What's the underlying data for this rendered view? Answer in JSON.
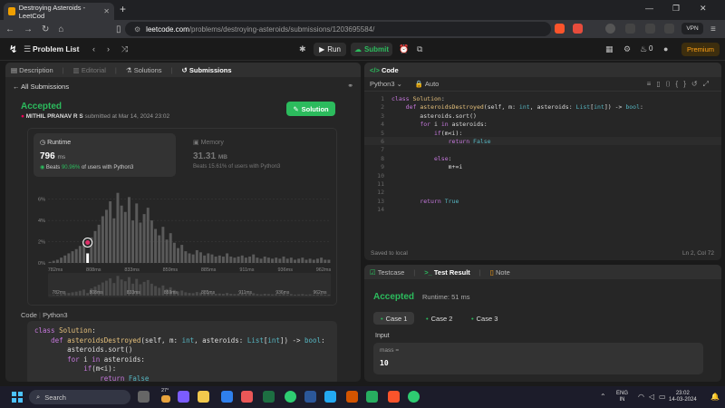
{
  "browser": {
    "tab_title": "Destroying Asteroids - LeetCod",
    "url_host": "leetcode.com",
    "url_path": "/problems/destroying-asteroids/submissions/1203695584/",
    "vpn_label": "VPN"
  },
  "header": {
    "problem_list": "Problem List",
    "run": "Run",
    "submit": "Submit",
    "streak_count": "0",
    "premium": "Premium"
  },
  "left_tabs": [
    "Description",
    "Editorial",
    "Solutions",
    "Submissions"
  ],
  "submission": {
    "back_label": "All Submissions",
    "status": "Accepted",
    "user": "MITHIL PRANAV R S",
    "submitted_text": "submitted at Mar 14, 2024 23:02",
    "solution_button": "Solution",
    "runtime_label": "Runtime",
    "runtime_value": "796",
    "runtime_unit": "ms",
    "runtime_beats_pre": "Beats",
    "runtime_beats_pct": "90.96%",
    "runtime_beats_post": "of users with Python3",
    "memory_label": "Memory",
    "memory_value": "31.31",
    "memory_unit": "MB",
    "memory_beats": "Beats 15.61% of users with Python3",
    "code_label": "Code",
    "code_lang": "Python3"
  },
  "chart_data": {
    "type": "bar",
    "title": "",
    "xlabel": "",
    "ylabel": "",
    "y_ticks": [
      "6%",
      "4%",
      "2%",
      "0%"
    ],
    "ylim": [
      0,
      7
    ],
    "x_ticks": [
      "782ms",
      "808ms",
      "833ms",
      "859ms",
      "885ms",
      "911ms",
      "936ms",
      "962ms"
    ],
    "values": [
      0.1,
      0.2,
      0.3,
      0.5,
      0.7,
      0.9,
      1.1,
      1.3,
      1.6,
      2.0,
      0.9,
      2.4,
      3.0,
      3.6,
      4.4,
      5.0,
      5.8,
      4.2,
      6.6,
      5.4,
      4.8,
      6.2,
      4.0,
      5.6,
      3.8,
      4.6,
      5.2,
      4.0,
      3.2,
      2.6,
      3.4,
      2.2,
      2.8,
      1.9,
      1.4,
      1.7,
      1.1,
      0.9,
      0.8,
      1.2,
      1.0,
      0.7,
      0.9,
      0.8,
      0.6,
      0.7,
      0.6,
      0.9,
      0.6,
      0.5,
      0.6,
      0.7,
      0.5,
      0.6,
      0.8,
      0.5,
      0.4,
      0.6,
      0.5,
      0.4,
      0.5,
      0.4,
      0.6,
      0.4,
      0.5,
      0.3,
      0.4,
      0.5,
      0.3,
      0.4,
      0.3,
      0.4,
      0.5,
      0.3,
      0.3
    ],
    "highlight_index": 10,
    "grid": true
  },
  "code_snippet": [
    "class Solution:",
    "    def asteroidsDestroyed(self, m: int, asteroids: List[int]) -> bool:",
    "        asteroids.sort()",
    "        for i in asteroids:",
    "            if(m<i):",
    "                return False"
  ],
  "editor": {
    "tab": "Code",
    "language": "Python3",
    "mode": "Auto",
    "lines": [
      "class Solution:",
      "    def asteroidsDestroyed(self, m: int, asteroids: List[int]) -> bool:",
      "        asteroids.sort()",
      "        for i in asteroids:",
      "            if(m<i):",
      "                return False",
      "",
      "            else:",
      "                m+=i",
      "",
      "",
      "",
      "        return True",
      ""
    ],
    "saved_status": "Saved to local",
    "cursor_pos": "Ln 2, Col 72"
  },
  "result": {
    "tabs": [
      "Testcase",
      "Test Result",
      "Note"
    ],
    "status": "Accepted",
    "runtime": "Runtime: 51 ms",
    "cases": [
      "Case 1",
      "Case 2",
      "Case 3"
    ],
    "input_label": "Input",
    "input_key": "mass =",
    "input_value": "10"
  },
  "taskbar": {
    "search_placeholder": "Search",
    "weather": "27°",
    "lang_line1": "ENG",
    "lang_line2": "IN",
    "time": "23:02",
    "date": "14-03-2024"
  },
  "colors": {
    "accent_green": "#2cbb5d",
    "premium_orange": "#ffa116",
    "panel_bg": "#262626"
  }
}
